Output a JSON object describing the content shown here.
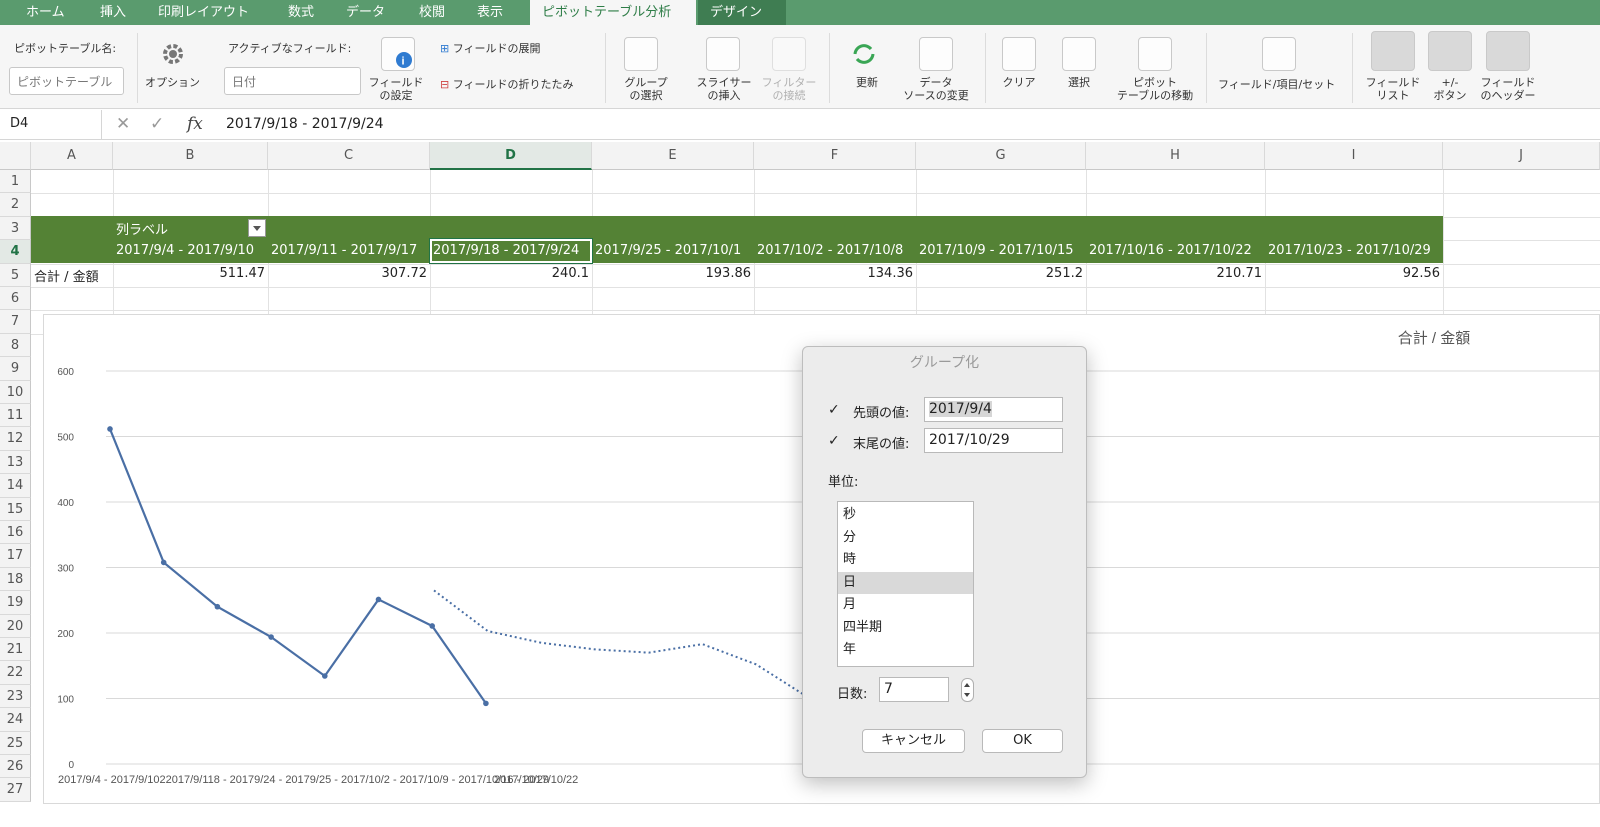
{
  "ribbon_tabs": [
    "ホーム",
    "挿入",
    "印刷レイアウト",
    "数式",
    "データ",
    "校閲",
    "表示",
    "ピボットテーブル分析",
    "デザイン"
  ],
  "ribbon": {
    "pivot_name_label": "ピボットテーブル名:",
    "pivot_name_value": "ピボットテーブル",
    "options_label": "オプション",
    "active_field_label": "アクティブなフィールド:",
    "active_field_value": "日付",
    "field_settings": "フィールド\nの設定",
    "expand_field": "フィールドの展開",
    "collapse_field": "フィールドの折りたたみ",
    "group_selection": "グループ\nの選択",
    "insert_slicer": "スライサー\nの挿入",
    "filter_connections": "フィルター\nの接続",
    "refresh": "更新",
    "change_source": "データ\nソースの変更",
    "clear": "クリア",
    "select": "選択",
    "move_pivot": "ピボット\nテーブルの移動",
    "fields_items_sets": "フィールド/項目/セット",
    "field_list": "フィールド\nリスト",
    "plus_minus_buttons": "+/-\nボタン",
    "field_headers": "フィールド\nのヘッダー"
  },
  "formula_bar": {
    "name_box": "D4",
    "fx": "fx",
    "formula": "2017/9/18 - 2017/9/24"
  },
  "sheet": {
    "columns": [
      "A",
      "B",
      "C",
      "D",
      "E",
      "F",
      "G",
      "H",
      "I",
      "J"
    ],
    "selected_column": "D",
    "selected_row": "4",
    "row_numbers": [
      "1",
      "2",
      "3",
      "4",
      "5",
      "6",
      "7",
      "8",
      "9",
      "10",
      "11",
      "12",
      "13",
      "14",
      "15",
      "16",
      "17",
      "18",
      "19",
      "20",
      "21",
      "22",
      "23",
      "24",
      "25",
      "26",
      "27"
    ],
    "col_label_header": "列ラベル",
    "row_label": "合計 / 金額",
    "date_headers": [
      "2017/9/4 - 2017/9/10",
      "2017/9/11 - 2017/9/17",
      "2017/9/18 - 2017/9/24",
      "2017/9/25 - 2017/10/1",
      "2017/10/2 - 2017/10/8",
      "2017/10/9 - 2017/10/15",
      "2017/10/16 - 2017/10/22",
      "2017/10/23 - 2017/10/29"
    ],
    "values": [
      "511.47",
      "307.72",
      "240.1",
      "193.86",
      "134.36",
      "251.2",
      "210.71",
      "92.56"
    ]
  },
  "chart_data": {
    "type": "line",
    "title": "合計 /  金額",
    "ylim": [
      0,
      600
    ],
    "y_ticks": [
      "0",
      "100",
      "200",
      "300",
      "400",
      "500",
      "600"
    ],
    "x_axis_overlapping_labels": "2017/9/4 - 2017/9/1022017/9/118 - 20179/24 - 20179/25 - 2017/10/2 - 2017/10/9 - 2017/10/16 - 2017/10/22",
    "x_axis_last_label": "2017/10/29",
    "series": [
      {
        "name": "合計 /  金額",
        "values": [
          511.47,
          307.72,
          240.1,
          193.86,
          134.36,
          251.2,
          210.71,
          92.56
        ],
        "style": "solid",
        "color": "#4a6fa5"
      },
      {
        "values": [
          265,
          203,
          185,
          175,
          170,
          183,
          152,
          100
        ],
        "style": "dotted",
        "color": "#4a6fa5"
      }
    ]
  },
  "dialog": {
    "title": "グループ化",
    "start_label": "先頭の値:",
    "start_value": "2017/9/4",
    "end_label": "末尾の値:",
    "end_value": "2017/10/29",
    "unit_label": "単位:",
    "units": [
      "秒",
      "分",
      "時",
      "日",
      "月",
      "四半期",
      "年"
    ],
    "selected_unit": "日",
    "days_label": "日数:",
    "days_value": "7",
    "cancel": "キャンセル",
    "ok": "OK"
  }
}
